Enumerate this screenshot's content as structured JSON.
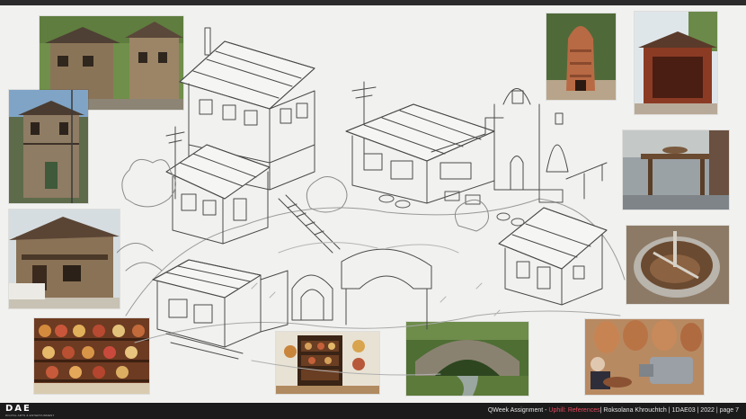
{
  "footer": {
    "logo": "DAE",
    "logo_subtitle": "DIGITAL ARTS & ENTERTAINMENT",
    "course": "QWeek Assignment - ",
    "highlight": "Uphill: References",
    "meta": "| Roksolana Khrouchtch | 1DAE03 | 2022 | page 7"
  },
  "colors": {
    "accent": "#e84a5f",
    "background": "#f1f1ef",
    "footer": "#1b1b1b"
  }
}
